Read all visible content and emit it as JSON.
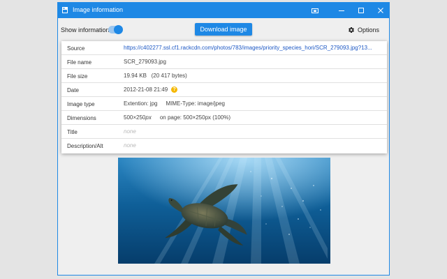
{
  "window": {
    "title": "Image information",
    "titlebar_buttons": [
      "restore-icon",
      "minimize-icon",
      "maximize-icon",
      "close-icon"
    ]
  },
  "toolbar": {
    "show_information_label": "Show information",
    "show_information_on": true,
    "download_label": "Download image",
    "options_label": "Options"
  },
  "info": {
    "source_label": "Source",
    "source_value": "https://c402277.ssl.cf1.rackcdn.com/photos/783/images/priority_species_hori/SCR_279093.jpg?13...",
    "filename_label": "File name",
    "filename_value": "SCR_279093.jpg",
    "filesize_label": "File size",
    "filesize_value": "19.94 KB",
    "filesize_bytes": "(20 417 bytes)",
    "date_label": "Date",
    "date_value": "2012-21-08 21:49",
    "date_help": "?",
    "type_label": "Image type",
    "type_extension": "Extention: jpg",
    "type_mime": "MIME-Type: image/jpeg",
    "dimensions_label": "Dimensions",
    "dimensions_w": "500",
    "dimensions_times": "×",
    "dimensions_h": "250",
    "dimensions_unit": "px",
    "dimensions_onpage": "on page: 500×250px (100%)",
    "title_label": "Title",
    "title_value": "none",
    "description_label": "Description/Alt",
    "description_value": "none"
  },
  "preview": {
    "subject": "sea turtle swimming underwater"
  },
  "colors": {
    "accent": "#1e88e5",
    "link": "#1b57c4",
    "help_badge": "#f5b800"
  }
}
